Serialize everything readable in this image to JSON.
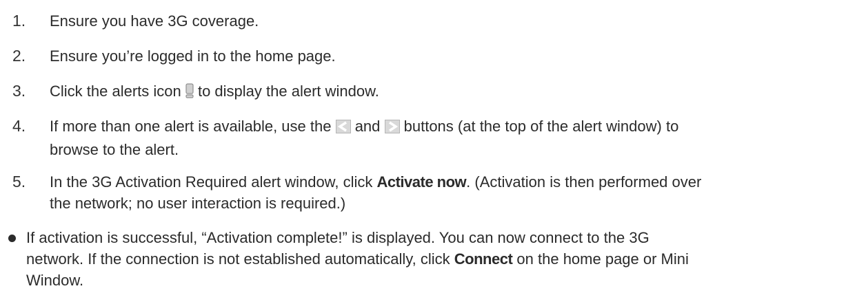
{
  "steps": [
    {
      "num": "1.",
      "text": "Ensure you have 3G coverage."
    },
    {
      "num": "2.",
      "text": "Ensure you’re logged in to the home page."
    },
    {
      "num": "3.",
      "before": "Click the alerts icon ",
      "after": " to display the alert window.",
      "icon": "alert-exclamation-icon"
    },
    {
      "num": "4.",
      "line1_a": "If more than one alert is available, use the ",
      "and": " and ",
      "line1_b": " buttons (at the top of the alert window) to",
      "line2": "browse to the alert.",
      "icons": [
        "previous-arrow-icon",
        "next-arrow-icon"
      ]
    },
    {
      "num": "5.",
      "line1_a": "In the 3G Activation Required alert window, click ",
      "bold": "Activate now",
      "line1_b": ". (Activation is then performed over",
      "line2": "the network; no user interaction is required.)"
    }
  ],
  "result": {
    "line1": "If activation is successful, “Activation complete!” is displayed. You can now connect to the 3G",
    "line2_a": "network. If the connection is not established automatically, click ",
    "bold": "Connect",
    "line2_b": " on the home page or Mini",
    "line3": "Window."
  },
  "colors": {
    "text": "#2b2b2b",
    "icon_fill": "#d0d0d0",
    "icon_border": "#8f8f8f"
  }
}
